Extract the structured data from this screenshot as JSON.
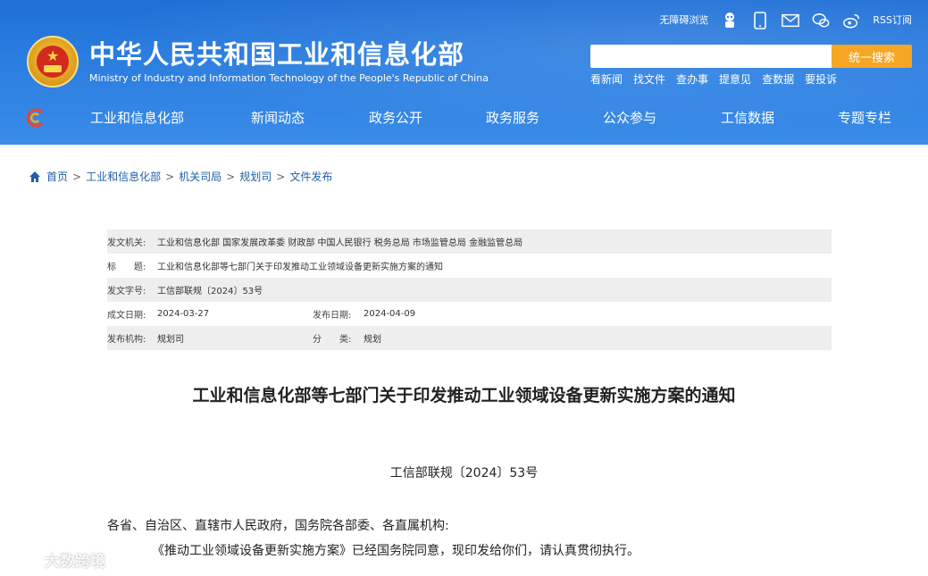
{
  "header": {
    "site_title": "中华人民共和国工业和信息化部",
    "site_subtitle": "Ministry of Industry and Information Technology of the People's Republic of China",
    "top_tools": {
      "accessibility": "无障碍浏览",
      "rss": "RSS订阅"
    },
    "search": {
      "placeholder": "",
      "button": "统一搜索"
    },
    "quick_links": [
      "看新闻",
      "找文件",
      "查办事",
      "提意见",
      "查数据",
      "要投诉"
    ]
  },
  "nav": {
    "items": [
      "工业和信息化部",
      "新闻动态",
      "政务公开",
      "政务服务",
      "公众参与",
      "工信数据",
      "专题专栏"
    ]
  },
  "breadcrumb": [
    "首页",
    "工业和信息化部",
    "机关司局",
    "规划司",
    "文件发布"
  ],
  "meta": {
    "issuer_label": "发文机关:",
    "issuer": "工业和信息化部 国家发展改革委 财政部 中国人民银行 税务总局 市场监管总局 金融监管总局",
    "title_label": "标　　题:",
    "title": "工业和信息化部等七部门关于印发推动工业领域设备更新实施方案的通知",
    "doc_no_label": "发文字号:",
    "doc_no": "工信部联规〔2024〕53号",
    "created_label": "成文日期:",
    "created": "2024-03-27",
    "published_label": "发布日期:",
    "published": "2024-04-09",
    "org_label": "发布机构:",
    "org": "规划司",
    "category_label": "分　　类:",
    "category": "规划"
  },
  "document": {
    "title": "工业和信息化部等七部门关于印发推动工业领域设备更新实施方案的通知",
    "number": "工信部联规〔2024〕53号",
    "salutation": "各省、自治区、直辖市人民政府，国务院各部委、各直属机构:",
    "body": "《推动工业领域设备更新实施方案》已经国务院同意，现印发给你们，请认真贯彻执行。"
  },
  "watermark": "大数跨境",
  "colors": {
    "header_blue": "#2a7de0",
    "search_button": "#f5a623",
    "link_blue": "#1f5ea8"
  }
}
